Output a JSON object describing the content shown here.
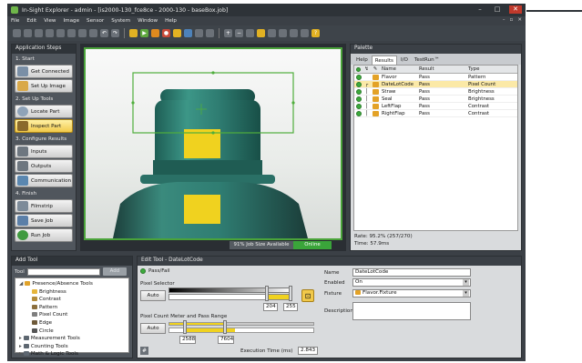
{
  "window": {
    "title": "In-Sight Explorer - admin - [is2000-130_fce8ce - 2000-130 - baseBox.job]"
  },
  "menu": [
    "File",
    "Edit",
    "View",
    "Image",
    "Sensor",
    "System",
    "Window",
    "Help"
  ],
  "application_steps": {
    "title": "Application Steps",
    "sections": [
      {
        "label": "1. Start",
        "buttons": [
          {
            "label": "Get Connected",
            "active": false
          },
          {
            "label": "Set Up Image",
            "active": false
          }
        ]
      },
      {
        "label": "2. Set Up Tools",
        "buttons": [
          {
            "label": "Locate Part",
            "active": false
          },
          {
            "label": "Inspect Part",
            "active": true
          }
        ]
      },
      {
        "label": "3. Configure Results",
        "buttons": [
          {
            "label": "Inputs",
            "active": false
          },
          {
            "label": "Outputs",
            "active": false
          },
          {
            "label": "Communication",
            "active": false
          }
        ]
      },
      {
        "label": "4. Finish",
        "buttons": [
          {
            "label": "Filmstrip",
            "active": false
          },
          {
            "label": "Save Job",
            "active": false
          },
          {
            "label": "Run Job",
            "active": false
          }
        ]
      }
    ]
  },
  "viewer": {
    "job_size": "91% Job Size Available",
    "status": "Online"
  },
  "palette": {
    "title": "Palette",
    "tabs": [
      {
        "label": "Help",
        "selected": false
      },
      {
        "label": "Results",
        "selected": true
      },
      {
        "label": "I/O",
        "selected": false
      },
      {
        "label": "TestRun™",
        "selected": false
      }
    ],
    "columns": {
      "name": "Name",
      "result": "Result",
      "type": "Type"
    },
    "rows": [
      {
        "name": "Flavor",
        "result": "Pass",
        "type": "Pattern",
        "selected": false
      },
      {
        "name": "DateLotCode",
        "result": "Pass",
        "type": "Pixel Count",
        "selected": true
      },
      {
        "name": "Straw",
        "result": "Pass",
        "type": "Brightness",
        "selected": false
      },
      {
        "name": "Seal",
        "result": "Pass",
        "type": "Brightness",
        "selected": false
      },
      {
        "name": "LeftFlap",
        "result": "Pass",
        "type": "Contrast",
        "selected": false
      },
      {
        "name": "RightFlap",
        "result": "Pass",
        "type": "Contrast",
        "selected": false
      }
    ],
    "rate": "Rate: 95.2% (257/270)",
    "time": "Time: 57.9ms"
  },
  "add_tool": {
    "title": "Add Tool",
    "search_label": "Tool",
    "add_label": "Add",
    "tree": [
      {
        "label": "Presence/Absence Tools",
        "level": 0,
        "expanded": true,
        "icon_color": "#e0a22a"
      },
      {
        "label": "Brightness",
        "level": 1,
        "icon_color": "#e6b53b"
      },
      {
        "label": "Contrast",
        "level": 1,
        "icon_color": "#b38b3a"
      },
      {
        "label": "Pattern",
        "level": 1,
        "icon_color": "#8c6f3d"
      },
      {
        "label": "Pixel Count",
        "level": 1,
        "icon_color": "#7f7f7f"
      },
      {
        "label": "Edge",
        "level": 1,
        "icon_color": "#6e5a3a"
      },
      {
        "label": "Circle",
        "level": 1,
        "icon_color": "#555555"
      },
      {
        "label": "Measurement Tools",
        "level": 0,
        "expanded": false,
        "icon_color": "#5d6670"
      },
      {
        "label": "Counting Tools",
        "level": 0,
        "expanded": false,
        "icon_color": "#5d6670"
      },
      {
        "label": "Math & Logic Tools",
        "level": 0,
        "expanded": false,
        "icon_color": "#5d6670"
      }
    ]
  },
  "edit_tool": {
    "title": "Edit Tool - DateLotCode",
    "pass_fail_label": "Pass/Fail",
    "pixel_selector_label": "Pixel Selector",
    "auto_label": "Auto",
    "pixel_low": "204",
    "pixel_high": "255",
    "meter_label": "Pixel Count Meter and Pass Range",
    "meter_auto_label": "Auto",
    "range_low": "2588",
    "range_high": "7604",
    "exec_label": "Execution Time (ms)",
    "exec_value": "2.843",
    "name_label": "Name",
    "name_value": "DateLotCode",
    "enabled_label": "Enabled",
    "enabled_value": "On",
    "fixture_label": "Fixture",
    "fixture_value": "Flavor.Fixture",
    "description_label": "Description"
  },
  "colors": {
    "accent_green": "#3caa3c",
    "highlight_yellow": "#f1c94a",
    "roi_yellow": "#f0d21f",
    "bottle_teal": "#2f7d72"
  }
}
